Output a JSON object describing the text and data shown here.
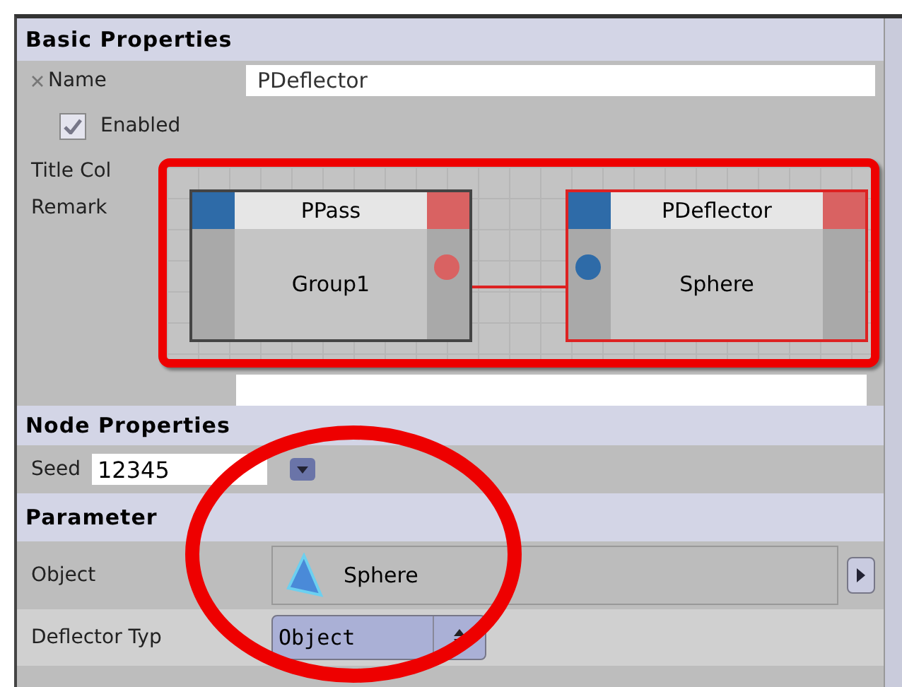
{
  "basic_properties": {
    "title": "Basic Properties",
    "name": {
      "label": "Name",
      "value": "PDeflector"
    },
    "enabled": {
      "label": "Enabled",
      "checked": true
    },
    "title_color": {
      "label": "Title Col"
    },
    "remark": {
      "label": "Remark"
    }
  },
  "node_graph": {
    "nodes": [
      {
        "title": "PPass",
        "body": "Group1",
        "selected": false
      },
      {
        "title": "PDeflector",
        "body": "Sphere",
        "selected": true
      }
    ]
  },
  "node_properties": {
    "title": "Node Properties",
    "seed": {
      "label": "Seed",
      "value": "12345"
    }
  },
  "parameter": {
    "title": "Parameter",
    "object": {
      "label": "Object",
      "value": "Sphere"
    },
    "deflector_type": {
      "label": "Deflector Typ",
      "value": "Object"
    }
  }
}
